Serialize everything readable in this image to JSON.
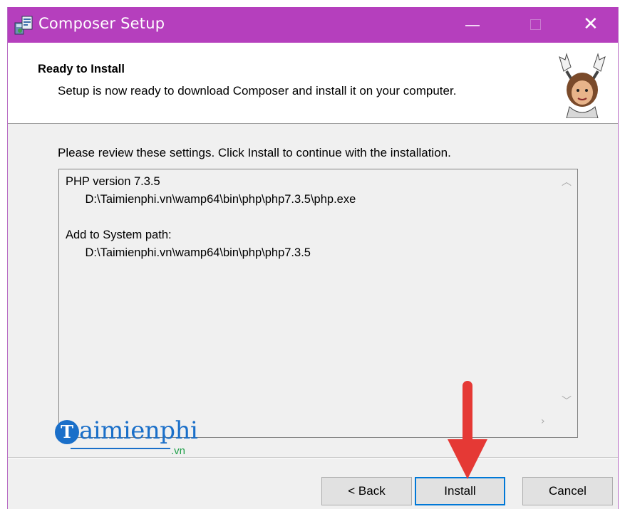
{
  "window": {
    "title": "Composer Setup",
    "titlebar_color": "#b53fbd",
    "icons": {
      "app": "setup-installer-icon",
      "minimize": "minimize-icon",
      "maximize": "maximize-icon",
      "close": "close-icon"
    }
  },
  "header": {
    "title": "Ready to Install",
    "subtitle": "Setup is now ready to download Composer and install it on your computer.",
    "image": "composer-mascot-icon"
  },
  "body": {
    "instruction": "Please review these settings. Click Install to continue with the installation.",
    "settings_lines": [
      "PHP version 7.3.5",
      "      D:\\Taimienphi.vn\\wamp64\\bin\\php\\php7.3.5\\php.exe",
      "",
      "Add to System path:",
      "      D:\\Taimienphi.vn\\wamp64\\bin\\php\\php7.3.5"
    ]
  },
  "watermark": {
    "letter": "T",
    "name": "aimienphi",
    "suffix": ".vn"
  },
  "buttons": {
    "back": "< Back",
    "install": "Install",
    "cancel": "Cancel"
  },
  "colors": {
    "focus_border": "#0078d7",
    "arrow": "#e53935",
    "watermark_blue": "#1a6fc9",
    "watermark_green": "#21a04a"
  }
}
